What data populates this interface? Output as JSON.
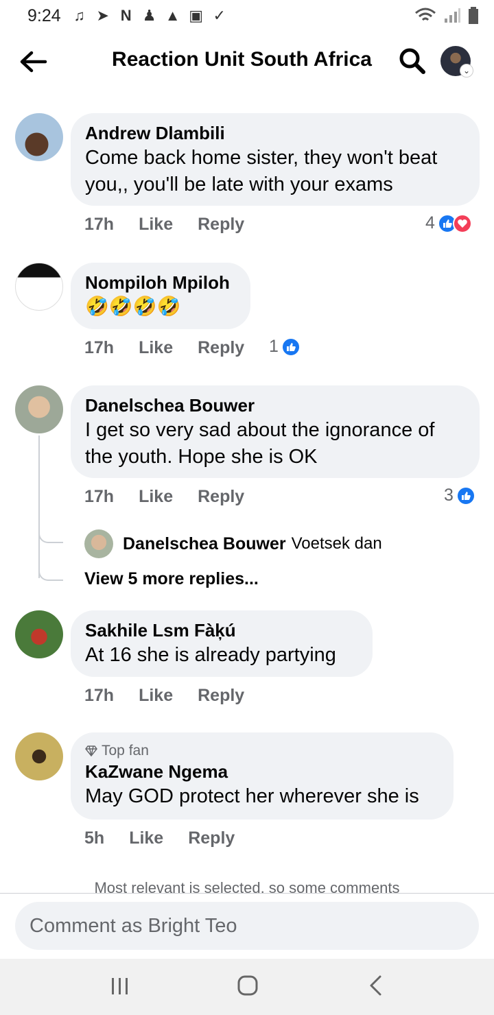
{
  "status_bar": {
    "time": "9:24"
  },
  "header": {
    "title": "Reaction Unit South Africa"
  },
  "comments": [
    {
      "author": "Andrew Dlambili",
      "text_lines": [
        "Come back home sister, they won't beat",
        "you,, you'll be late with your exams"
      ],
      "time": "17h",
      "like_label": "Like",
      "reply_label": "Reply",
      "reaction_count": "4",
      "reactions": [
        "like",
        "love"
      ]
    },
    {
      "author": "Nompiloh Mpiloh",
      "text_emoji": "🤣🤣🤣🤣",
      "time": "17h",
      "like_label": "Like",
      "reply_label": "Reply",
      "reaction_count": "1",
      "reactions": [
        "like"
      ]
    },
    {
      "author": "Danelschea Bouwer",
      "text_lines": [
        "I get so very sad about the ignorance of",
        "the youth. Hope she is OK"
      ],
      "time": "17h",
      "like_label": "Like",
      "reply_label": "Reply",
      "reaction_count": "3",
      "reactions": [
        "like"
      ],
      "reply_preview": {
        "author": "Danelschea Bouwer",
        "text": "Voetsek dan"
      },
      "view_more": "View 5 more replies..."
    },
    {
      "author": "Sakhile Lsm Fàķú",
      "text_lines": [
        "At 16 she is already partying"
      ],
      "time": "17h",
      "like_label": "Like",
      "reply_label": "Reply"
    },
    {
      "badge": "Top fan",
      "author": "KaZwane Ngema",
      "text_lines": [
        "May GOD protect her wherever she is"
      ],
      "time": "5h",
      "like_label": "Like",
      "reply_label": "Reply"
    }
  ],
  "notice": "Most relevant is selected, so some comments",
  "composer": {
    "placeholder": "Comment as Bright Teo"
  },
  "colors": {
    "facebook_blue": "#1877f2",
    "love_red": "#f33e58",
    "bubble_bg": "#f0f2f5",
    "meta_gray": "#65676b"
  }
}
